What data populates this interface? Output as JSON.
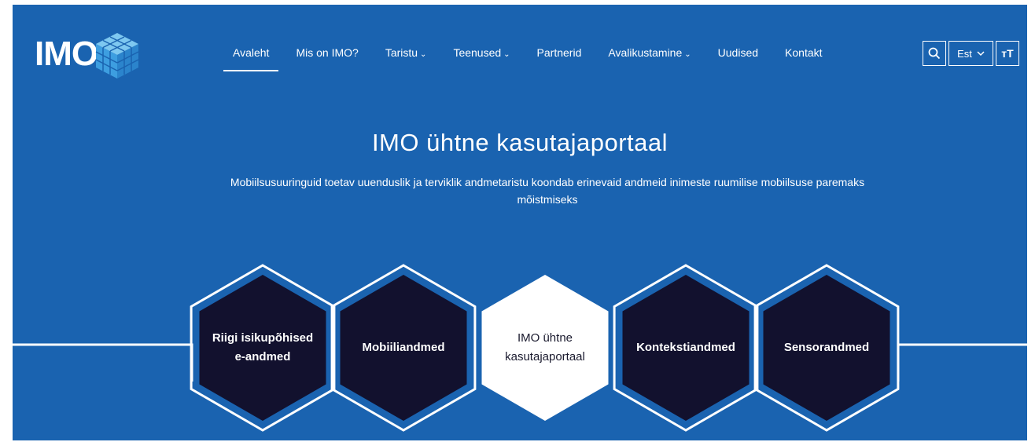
{
  "logo": {
    "text": "IMO",
    "icon": "cube-logo-icon"
  },
  "nav": {
    "items": [
      {
        "label": "Avaleht",
        "dropdown": false,
        "active": true
      },
      {
        "label": "Mis on IMO?",
        "dropdown": false,
        "active": false
      },
      {
        "label": "Taristu",
        "dropdown": true,
        "active": false
      },
      {
        "label": "Teenused",
        "dropdown": true,
        "active": false
      },
      {
        "label": "Partnerid",
        "dropdown": false,
        "active": false
      },
      {
        "label": "Avalikustamine",
        "dropdown": true,
        "active": false
      },
      {
        "label": "Uudised",
        "dropdown": false,
        "active": false
      },
      {
        "label": "Kontakt",
        "dropdown": false,
        "active": false
      }
    ]
  },
  "tools": {
    "search_icon": "search-icon",
    "language": "Est",
    "text_size_label": "тT"
  },
  "hero": {
    "title": "IMO ühtne kasutajaportaal",
    "subtitle": "Mobiilsusuuringuid toetav uuenduslik ja terviklik andmetaristu koondab erinevaid andmeid inimeste ruumilise mobiilsuse paremaks mõistmiseks"
  },
  "hexagons": [
    {
      "line1": "Riigi isikupõhised",
      "line2": "e-andmed",
      "style": "dark"
    },
    {
      "line1": "Mobiiliandmed",
      "line2": "",
      "style": "dark"
    },
    {
      "line1": "IMO ühtne",
      "line2": "kasutajaportaal",
      "style": "light"
    },
    {
      "line1": "Kontekstiandmed",
      "line2": "",
      "style": "dark"
    },
    {
      "line1": "Sensorandmed",
      "line2": "",
      "style": "dark"
    }
  ],
  "colors": {
    "background": "#1a63b0",
    "hex_dark": "#12112e",
    "hex_light": "#ffffff",
    "accent_line": "#ffffff"
  }
}
